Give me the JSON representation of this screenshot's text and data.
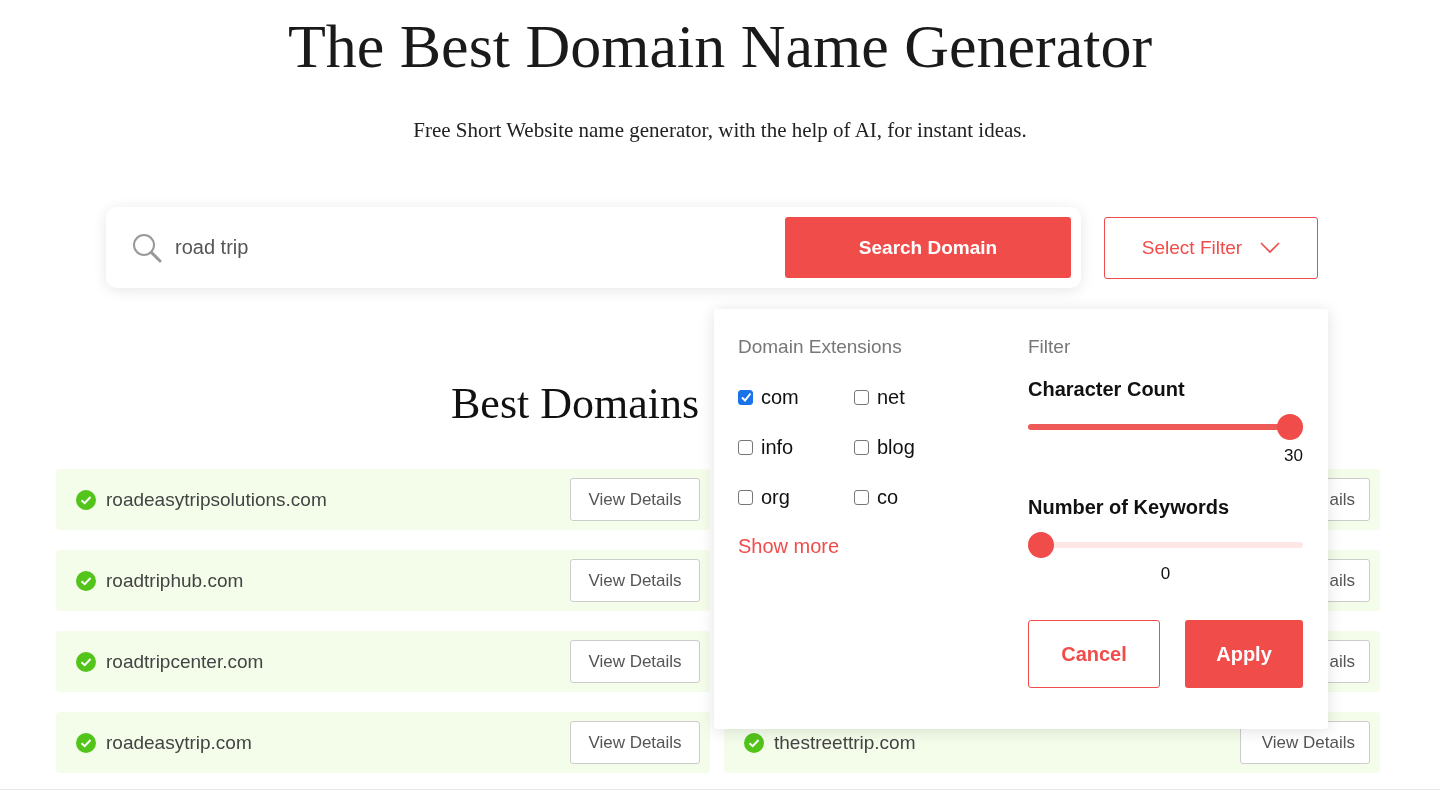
{
  "title": "The Best Domain Name Generator",
  "subtitle": "Free Short Website name generator, with the help of AI, for instant ideas.",
  "search": {
    "value": "road trip",
    "button": "Search Domain"
  },
  "filter_button": "Select Filter",
  "results_heading": "Best Domains",
  "results_left": [
    {
      "domain": "roadeasytripsolutions.com",
      "available": true,
      "button": "View Details"
    },
    {
      "domain": "roadtriphub.com",
      "available": true,
      "button": "View Details"
    },
    {
      "domain": "roadtripcenter.com",
      "available": true,
      "button": "View Details"
    },
    {
      "domain": "roadeasytrip.com",
      "available": true,
      "button": "View Details"
    }
  ],
  "results_right": [
    {
      "button": "ails"
    },
    {
      "button": "ails"
    },
    {
      "button": "ails"
    },
    {
      "domain": "thestreettrip.com",
      "available": true,
      "button": "View Details"
    }
  ],
  "filter_popup": {
    "extensions_title": "Domain Extensions",
    "extensions": [
      {
        "label": "com",
        "checked": true
      },
      {
        "label": "net",
        "checked": false
      },
      {
        "label": "info",
        "checked": false
      },
      {
        "label": "blog",
        "checked": false
      },
      {
        "label": "org",
        "checked": false
      },
      {
        "label": "co",
        "checked": false
      }
    ],
    "show_more": "Show more",
    "filter_title": "Filter",
    "sliders": [
      {
        "label": "Character Count",
        "level": 1,
        "reading": "30"
      },
      {
        "label": "Number of Keywords",
        "level": 0,
        "reading": "0"
      }
    ],
    "cancel": "Cancel",
    "apply": "Apply"
  }
}
